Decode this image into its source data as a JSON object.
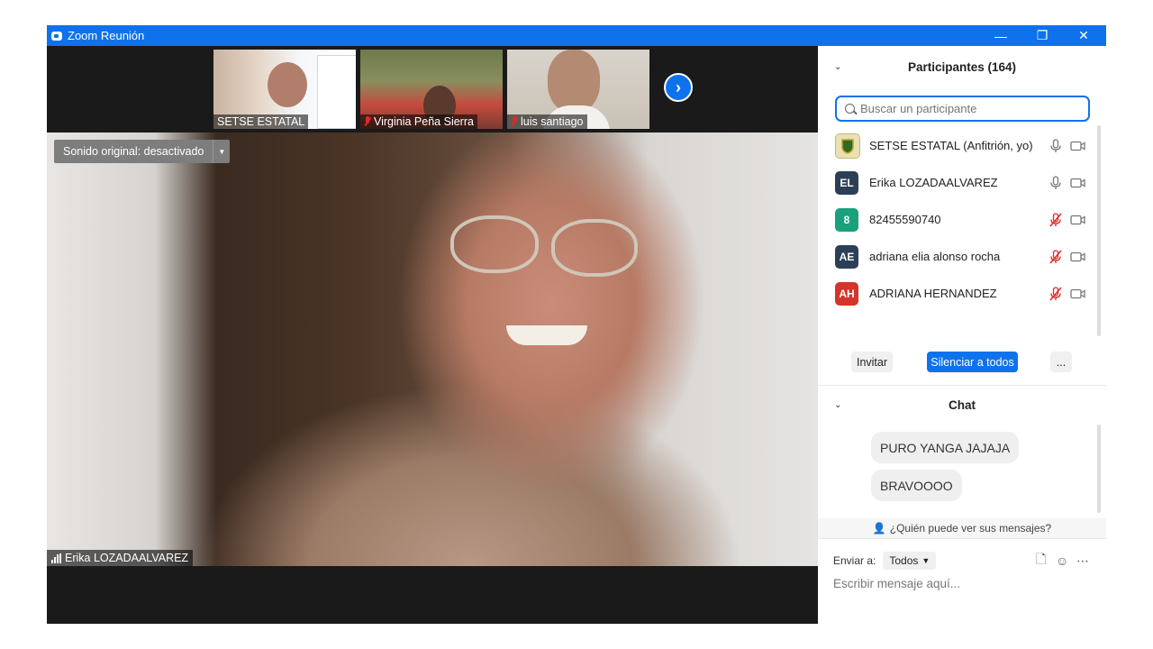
{
  "window": {
    "title": "Zoom Reunión",
    "controls": [
      "minimize-icon",
      "restore-icon",
      "close-icon"
    ]
  },
  "thumbnails": [
    {
      "name": "SETSE ESTATAL",
      "muted": false
    },
    {
      "name": "Virginia Peña Sierra",
      "muted": true
    },
    {
      "name": "luis santiago",
      "muted": true
    }
  ],
  "main_video": {
    "sound_label": "Sonido original: desactivado",
    "speaker_name": "Erika LOZADAALVAREZ"
  },
  "participants": {
    "title": "Participantes (164)",
    "search_placeholder": "Buscar un participante",
    "list": [
      {
        "initials": "",
        "name": "SETSE ESTATAL (Anfitrión, yo)",
        "color": "#e9e1b5",
        "muted": false
      },
      {
        "initials": "EL",
        "name": "Erika LOZADAALVAREZ",
        "color": "#2d3f57",
        "muted": false
      },
      {
        "initials": "8",
        "name": "82455590740",
        "color": "#1aa07a",
        "muted": true
      },
      {
        "initials": "AE",
        "name": "adriana elia alonso rocha",
        "color": "#2d3f57",
        "muted": true
      },
      {
        "initials": "AH",
        "name": "ADRIANA HERNANDEZ",
        "color": "#d4342a",
        "muted": true
      }
    ],
    "buttons": {
      "invite": "Invitar",
      "mute_all": "Silenciar a todos",
      "more": "..."
    }
  },
  "chat": {
    "title": "Chat",
    "messages": [
      "PURO YANGA JAJAJA",
      "BRAVOOOO"
    ],
    "who_can_see": "¿Quién puede ver sus mensajes?",
    "send_to_label": "Enviar a:",
    "send_to_value": "Todos",
    "input_placeholder": "Escribir mensaje aquí..."
  },
  "colors": {
    "accent": "#0e72ed",
    "muted_red": "#e02828"
  }
}
